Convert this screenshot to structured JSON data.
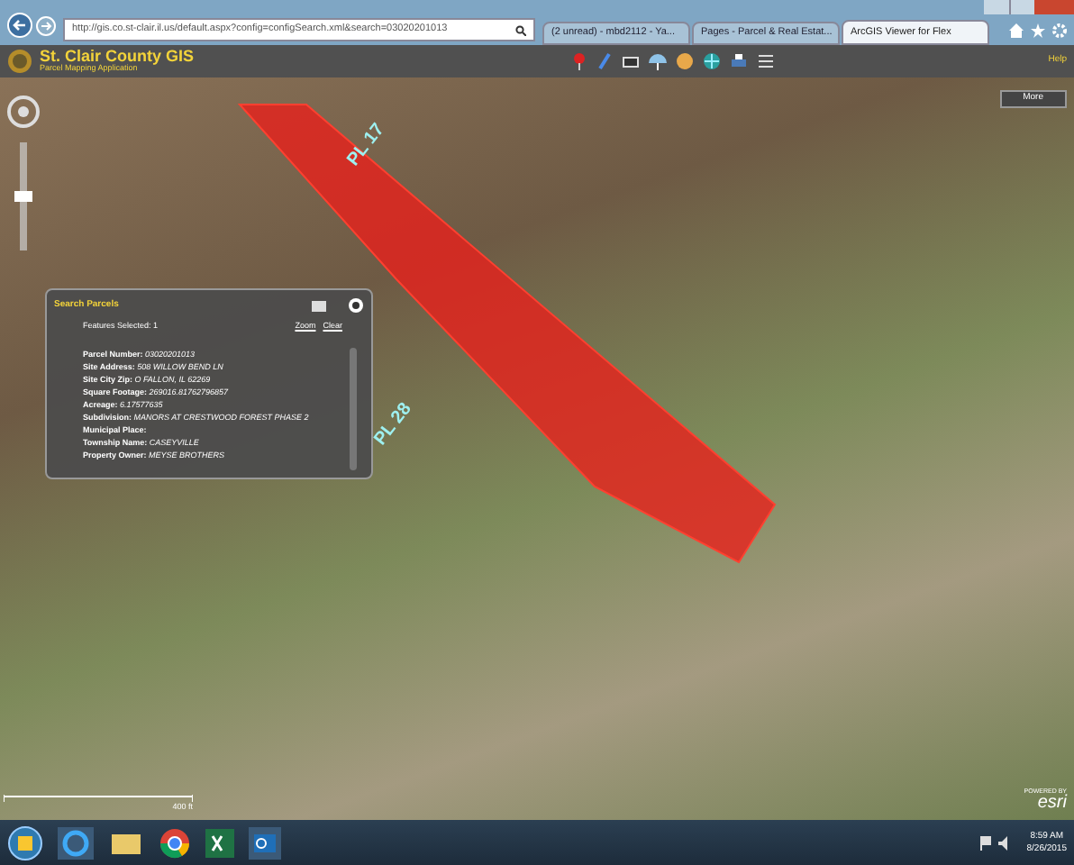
{
  "browser": {
    "address": "http://gis.co.st-clair.il.us/default.aspx?config=configSearch.xml&search=03020201013",
    "tabs": [
      {
        "label": "(2 unread) - mbd2112 - Ya...",
        "selected": false
      },
      {
        "label": "Pages - Parcel & Real Estat...",
        "selected": false
      },
      {
        "label": "ArcGIS Viewer for Flex",
        "selected": true
      }
    ]
  },
  "app": {
    "title": "St. Clair County GIS",
    "subtitle": "Parcel Mapping Application",
    "help": "Help",
    "more": "More"
  },
  "map": {
    "zoom": {
      "level": 0.5
    },
    "labels": [
      {
        "text": "PL 17",
        "kind": "parcel"
      },
      {
        "text": "PL 28",
        "kind": "parcel"
      }
    ],
    "scale": "400 ft",
    "credit_small": "POWERED BY",
    "credit": "esri"
  },
  "panel": {
    "title": "Search Parcels",
    "selected_text": "Features Selected: 1",
    "zoom": "Zoom",
    "clear": "Clear",
    "fields": [
      {
        "label": "Parcel Number:",
        "value": "03020201013"
      },
      {
        "label": "Site Address:",
        "value": "508 WILLOW BEND LN"
      },
      {
        "label": "Site City Zip:",
        "value": "O FALLON, IL 62269"
      },
      {
        "label": "Square Footage:",
        "value": "269016.81762796857"
      },
      {
        "label": "Acreage:",
        "value": "6.17577635"
      },
      {
        "label": "Subdivision:",
        "value": "MANORS AT CRESTWOOD FOREST PHASE 2"
      },
      {
        "label": "Municipal Place:"
      },
      {
        "label": "Township Name:",
        "value": "CASEYVILLE"
      },
      {
        "label": "Property Owner:",
        "value": "MEYSE BROTHERS"
      }
    ]
  },
  "taskbar": {
    "time": "8:59 AM",
    "date": "8/26/2015"
  }
}
